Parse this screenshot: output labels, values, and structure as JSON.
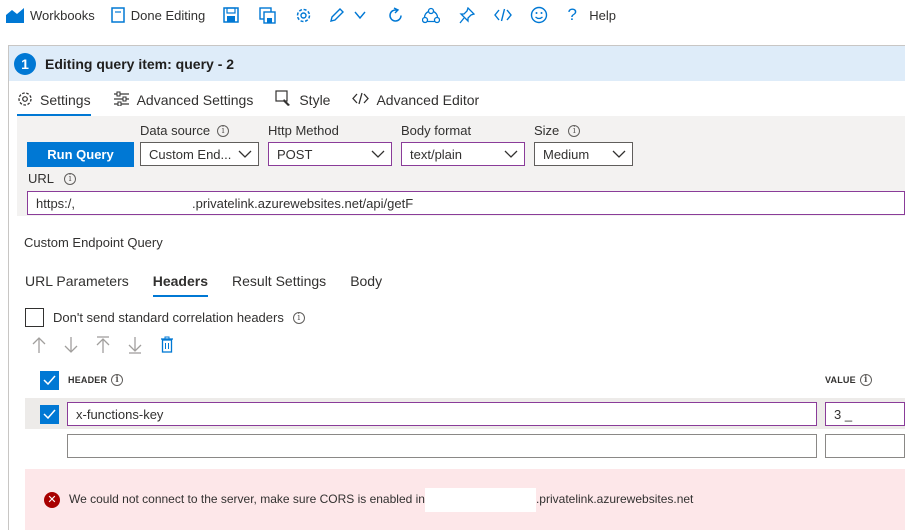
{
  "toolbar": {
    "workbooks_label": "Workbooks",
    "done_editing_label": "Done Editing",
    "help_label": "Help"
  },
  "step": {
    "number": "1",
    "title": "Editing query item: query - 2"
  },
  "settings_tabs": [
    {
      "label": "Settings",
      "active": true
    },
    {
      "label": "Advanced Settings",
      "active": false
    },
    {
      "label": "Style",
      "active": false
    },
    {
      "label": "Advanced Editor",
      "active": false
    }
  ],
  "query": {
    "run_label": "Run Query",
    "data_source_label": "Data source",
    "data_source_value": "Custom End...",
    "http_method_label": "Http Method",
    "http_method_value": "POST",
    "body_format_label": "Body format",
    "body_format_value": "text/plain",
    "size_label": "Size",
    "size_value": "Medium",
    "url_label": "URL",
    "url_prefix": "https:/,",
    "url_middle": ".privatelink.azurewebsites.net/api/getF"
  },
  "endpoint_title": "Custom Endpoint Query",
  "query_tabs": [
    {
      "label": "URL Parameters",
      "active": false
    },
    {
      "label": "Headers",
      "active": true
    },
    {
      "label": "Result Settings",
      "active": false
    },
    {
      "label": "Body",
      "active": false
    }
  ],
  "correlation_label": "Don't send standard correlation headers",
  "headers_table": {
    "header_col": "HEADER",
    "value_col": "VALUE",
    "rows": [
      {
        "header": "x-functions-key",
        "value": "3     _"
      },
      {
        "header": "",
        "value": ""
      }
    ]
  },
  "error": {
    "text_before": "We could not connect to the server, make sure CORS is enabled in",
    "text_after": ".privatelink.azurewebsites.net"
  },
  "colors": {
    "accent": "#0078d4",
    "step_bar": "#deecf9",
    "error_bg": "#fde7e9",
    "error_icon": "#a80000",
    "input_border_focus": "#8a3c99"
  }
}
